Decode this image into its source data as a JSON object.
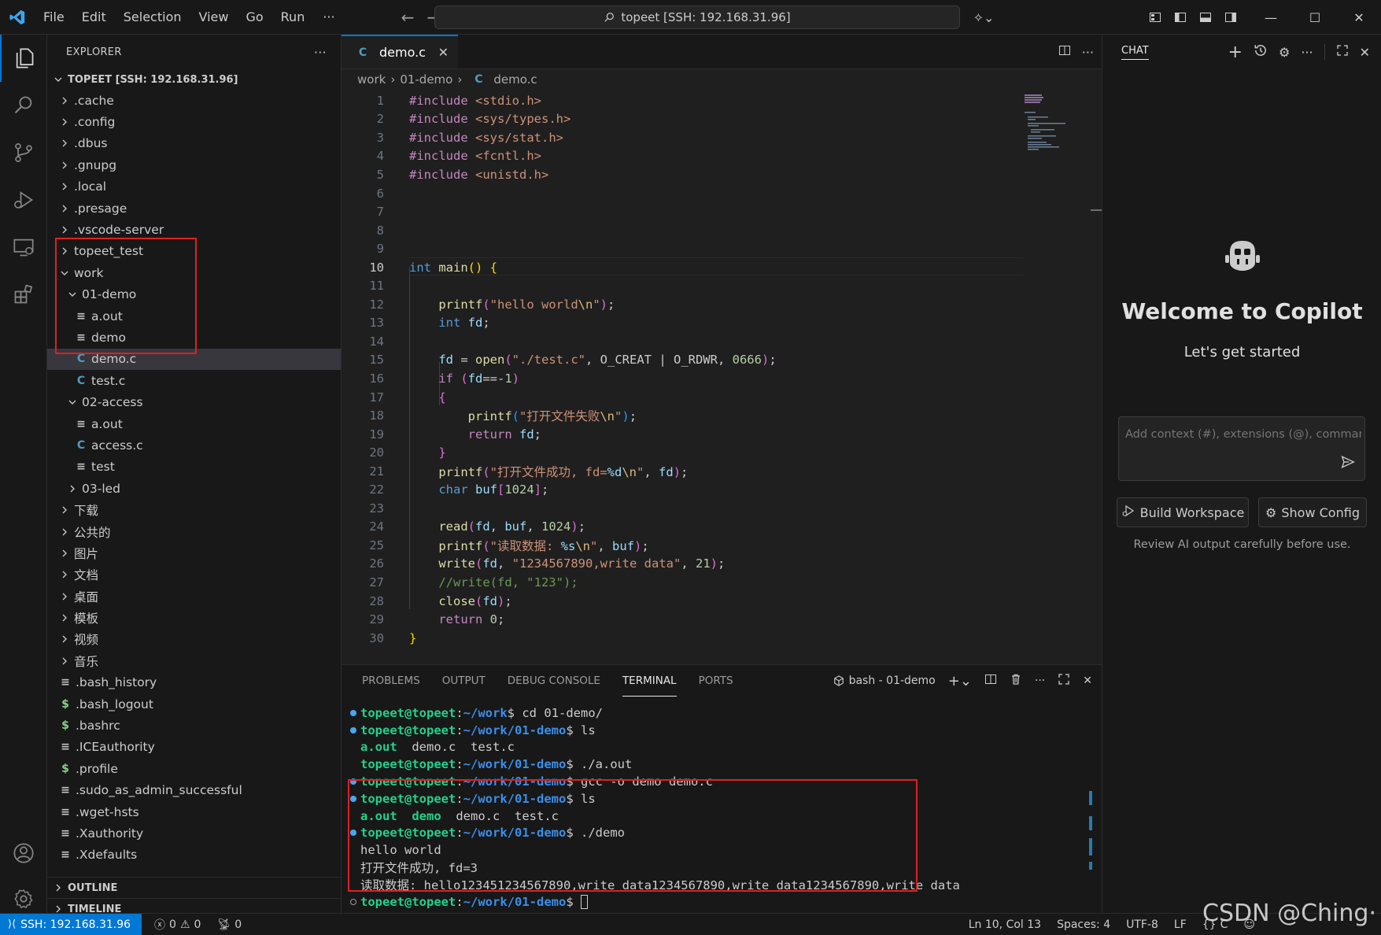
{
  "titlebar": {
    "menus": [
      "File",
      "Edit",
      "Selection",
      "View",
      "Go",
      "Run"
    ],
    "more": "···",
    "search_text": "topeet [SSH: 192.168.31.96]"
  },
  "explorer": {
    "title": "EXPLORER",
    "more": "···",
    "root": "TOPEET [SSH: 192.168.31.96]",
    "items": [
      {
        "label": ".cache",
        "kind": "folder",
        "depth": 1,
        "open": false
      },
      {
        "label": ".config",
        "kind": "folder",
        "depth": 1,
        "open": false
      },
      {
        "label": ".dbus",
        "kind": "folder",
        "depth": 1,
        "open": false
      },
      {
        "label": ".gnupg",
        "kind": "folder",
        "depth": 1,
        "open": false
      },
      {
        "label": ".local",
        "kind": "folder",
        "depth": 1,
        "open": false
      },
      {
        "label": ".presage",
        "kind": "folder",
        "depth": 1,
        "open": false
      },
      {
        "label": ".vscode-server",
        "kind": "folder",
        "depth": 1,
        "open": false
      },
      {
        "label": "topeet_test",
        "kind": "folder",
        "depth": 1,
        "open": false
      },
      {
        "label": "work",
        "kind": "folder",
        "depth": 1,
        "open": true
      },
      {
        "label": "01-demo",
        "kind": "folder",
        "depth": 2,
        "open": true
      },
      {
        "label": "a.out",
        "kind": "lines",
        "depth": 3
      },
      {
        "label": "demo",
        "kind": "lines",
        "depth": 3
      },
      {
        "label": "demo.c",
        "kind": "c",
        "depth": 3,
        "selected": true
      },
      {
        "label": "test.c",
        "kind": "c",
        "depth": 3
      },
      {
        "label": "02-access",
        "kind": "folder",
        "depth": 2,
        "open": true
      },
      {
        "label": "a.out",
        "kind": "lines",
        "depth": 3
      },
      {
        "label": "access.c",
        "kind": "c",
        "depth": 3
      },
      {
        "label": "test",
        "kind": "lines",
        "depth": 3
      },
      {
        "label": "03-led",
        "kind": "folder",
        "depth": 2,
        "open": false
      },
      {
        "label": "下载",
        "kind": "folder",
        "depth": 1,
        "open": false
      },
      {
        "label": "公共的",
        "kind": "folder",
        "depth": 1,
        "open": false
      },
      {
        "label": "图片",
        "kind": "folder",
        "depth": 1,
        "open": false
      },
      {
        "label": "文档",
        "kind": "folder",
        "depth": 1,
        "open": false
      },
      {
        "label": "桌面",
        "kind": "folder",
        "depth": 1,
        "open": false
      },
      {
        "label": "模板",
        "kind": "folder",
        "depth": 1,
        "open": false
      },
      {
        "label": "视频",
        "kind": "folder",
        "depth": 1,
        "open": false
      },
      {
        "label": "音乐",
        "kind": "folder",
        "depth": 1,
        "open": false
      },
      {
        "label": ".bash_history",
        "kind": "lines",
        "depth": 1
      },
      {
        "label": ".bash_logout",
        "kind": "dollar",
        "depth": 1
      },
      {
        "label": ".bashrc",
        "kind": "dollar",
        "depth": 1
      },
      {
        "label": ".ICEauthority",
        "kind": "lines",
        "depth": 1
      },
      {
        "label": ".profile",
        "kind": "dollar",
        "depth": 1
      },
      {
        "label": ".sudo_as_admin_successful",
        "kind": "lines",
        "depth": 1
      },
      {
        "label": ".wget-hsts",
        "kind": "lines",
        "depth": 1
      },
      {
        "label": ".Xauthority",
        "kind": "lines",
        "depth": 1
      },
      {
        "label": ".Xdefaults",
        "kind": "lines",
        "depth": 1
      }
    ],
    "outline": "OUTLINE",
    "timeline": "TIMELINE"
  },
  "editor": {
    "tab_label": "demo.c",
    "tab_icon": "C",
    "breadcrumb": [
      "work",
      "01-demo",
      "demo.c"
    ],
    "current_line": 10
  },
  "code": [
    [
      [
        "inc",
        "#include "
      ],
      [
        "str",
        "<stdio.h>"
      ]
    ],
    [
      [
        "inc",
        "#include "
      ],
      [
        "str",
        "<sys/types.h>"
      ]
    ],
    [
      [
        "inc",
        "#include "
      ],
      [
        "str",
        "<sys/stat.h>"
      ]
    ],
    [
      [
        "inc",
        "#include "
      ],
      [
        "str",
        "<fcntl.h>"
      ]
    ],
    [
      [
        "inc",
        "#include "
      ],
      [
        "str",
        "<unistd.h>"
      ]
    ],
    [],
    [],
    [],
    [],
    [
      [
        "kw",
        "int "
      ],
      [
        "fn",
        "main"
      ],
      [
        "br1",
        "()"
      ],
      [
        "",
        " "
      ],
      [
        "br1",
        "{"
      ]
    ],
    [],
    [
      [
        "",
        "    "
      ],
      [
        "fn",
        "printf"
      ],
      [
        "br2",
        "("
      ],
      [
        "str",
        "\"hello world"
      ],
      [
        "esc",
        "\\n"
      ],
      [
        "str",
        "\""
      ],
      [
        "br2",
        ")"
      ],
      [
        "",
        ";"
      ]
    ],
    [
      [
        "",
        "    "
      ],
      [
        "kw",
        "int "
      ],
      [
        "var",
        "fd"
      ],
      [
        "",
        ";"
      ]
    ],
    [],
    [
      [
        "",
        "    "
      ],
      [
        "var",
        "fd"
      ],
      [
        "",
        " = "
      ],
      [
        "fn",
        "open"
      ],
      [
        "br2",
        "("
      ],
      [
        "str",
        "\"./test.c\""
      ],
      [
        "",
        ", O_CREAT | O_RDWR, "
      ],
      [
        "num",
        "0666"
      ],
      [
        "br2",
        ")"
      ],
      [
        "",
        ";"
      ]
    ],
    [
      [
        "",
        "    "
      ],
      [
        "inc",
        "if "
      ],
      [
        "br2",
        "("
      ],
      [
        "var",
        "fd"
      ],
      [
        "",
        "=="
      ],
      [
        "",
        "-"
      ],
      [
        "num",
        "1"
      ],
      [
        "br2",
        ")"
      ]
    ],
    [
      [
        "",
        "    "
      ],
      [
        "br2",
        "{"
      ]
    ],
    [
      [
        "",
        "        "
      ],
      [
        "fn",
        "printf"
      ],
      [
        "br3",
        "("
      ],
      [
        "str",
        "\"打开文件失败"
      ],
      [
        "esc",
        "\\n"
      ],
      [
        "str",
        "\""
      ],
      [
        "br3",
        ")"
      ],
      [
        "",
        ";"
      ]
    ],
    [
      [
        "",
        "        "
      ],
      [
        "inc",
        "return "
      ],
      [
        "var",
        "fd"
      ],
      [
        "",
        ";"
      ]
    ],
    [
      [
        "",
        "    "
      ],
      [
        "br2",
        "}"
      ]
    ],
    [
      [
        "",
        "    "
      ],
      [
        "fn",
        "printf"
      ],
      [
        "br2",
        "("
      ],
      [
        "str",
        "\"打开文件成功, fd="
      ],
      [
        "var",
        "%d"
      ],
      [
        "esc",
        "\\n"
      ],
      [
        "str",
        "\""
      ],
      [
        "",
        ", "
      ],
      [
        "var",
        "fd"
      ],
      [
        "br2",
        ")"
      ],
      [
        "",
        ";"
      ]
    ],
    [
      [
        "",
        "    "
      ],
      [
        "kw",
        "char "
      ],
      [
        "var",
        "buf"
      ],
      [
        "br2",
        "["
      ],
      [
        "num",
        "1024"
      ],
      [
        "br2",
        "]"
      ],
      [
        "",
        ";"
      ]
    ],
    [],
    [
      [
        "",
        "    "
      ],
      [
        "fn",
        "read"
      ],
      [
        "br2",
        "("
      ],
      [
        "var",
        "fd"
      ],
      [
        "",
        ", "
      ],
      [
        "var",
        "buf"
      ],
      [
        "",
        ", "
      ],
      [
        "num",
        "1024"
      ],
      [
        "br2",
        ")"
      ],
      [
        "",
        ";"
      ]
    ],
    [
      [
        "",
        "    "
      ],
      [
        "fn",
        "printf"
      ],
      [
        "br2",
        "("
      ],
      [
        "str",
        "\"读取数据: "
      ],
      [
        "var",
        "%s"
      ],
      [
        "esc",
        "\\n"
      ],
      [
        "str",
        "\""
      ],
      [
        "",
        ", "
      ],
      [
        "var",
        "buf"
      ],
      [
        "br2",
        ")"
      ],
      [
        "",
        ";"
      ]
    ],
    [
      [
        "",
        "    "
      ],
      [
        "fn",
        "write"
      ],
      [
        "br2",
        "("
      ],
      [
        "var",
        "fd"
      ],
      [
        "",
        ", "
      ],
      [
        "str",
        "\"1234567890,write data\""
      ],
      [
        "",
        ", "
      ],
      [
        "num",
        "21"
      ],
      [
        "br2",
        ")"
      ],
      [
        "",
        ";"
      ]
    ],
    [
      [
        "",
        "    "
      ],
      [
        "cm",
        "//write(fd, \"123\");"
      ]
    ],
    [
      [
        "",
        "    "
      ],
      [
        "fn",
        "close"
      ],
      [
        "br2",
        "("
      ],
      [
        "var",
        "fd"
      ],
      [
        "br2",
        ")"
      ],
      [
        "",
        ";"
      ]
    ],
    [
      [
        "",
        "    "
      ],
      [
        "inc",
        "return "
      ],
      [
        "num",
        "0"
      ],
      [
        "",
        ";"
      ]
    ],
    [
      [
        "br1",
        "}"
      ]
    ]
  ],
  "panel": {
    "tabs": [
      "PROBLEMS",
      "OUTPUT",
      "DEBUG CONSOLE",
      "TERMINAL",
      "PORTS"
    ],
    "active_tab": "TERMINAL",
    "terminal_name": "bash - 01-demo"
  },
  "terminal": [
    {
      "dot": "blue",
      "prompt_user": "topeet@topeet",
      "prompt_path": "~/work",
      "cmd": "$ cd 01-demo/"
    },
    {
      "dot": "blue",
      "prompt_user": "topeet@topeet",
      "prompt_path": "~/work/01-demo",
      "cmd": "$ ls"
    },
    {
      "dot": "none",
      "out": [
        [
          "tgreen",
          "a.out"
        ],
        [
          "tplain",
          "  demo.c  test.c"
        ]
      ]
    },
    {
      "dot": "none",
      "prompt_user": "topeet@topeet",
      "prompt_path": "~/work/01-demo",
      "cmd": "$ ./a.out"
    },
    {
      "dot": "blue",
      "prompt_user": "topeet@topeet",
      "prompt_path": "~/work/01-demo",
      "cmd": "$ gcc -o demo demo.c"
    },
    {
      "dot": "blue",
      "prompt_user": "topeet@topeet",
      "prompt_path": "~/work/01-demo",
      "cmd": "$ ls"
    },
    {
      "dot": "none",
      "out": [
        [
          "tgreen",
          "a.out"
        ],
        [
          "tplain",
          "  "
        ],
        [
          "tgreen",
          "demo"
        ],
        [
          "tplain",
          "  demo.c  test.c"
        ]
      ]
    },
    {
      "dot": "blue",
      "prompt_user": "topeet@topeet",
      "prompt_path": "~/work/01-demo",
      "cmd": "$ ./demo"
    },
    {
      "dot": "none",
      "out": [
        [
          "tplain",
          "hello world"
        ]
      ]
    },
    {
      "dot": "none",
      "out": [
        [
          "tplain",
          "打开文件成功, fd=3"
        ]
      ]
    },
    {
      "dot": "none",
      "out": [
        [
          "tplain",
          "读取数据: hello123451234567890,write data1234567890,write data1234567890,write data"
        ]
      ]
    },
    {
      "dot": "hollow",
      "prompt_user": "topeet@topeet",
      "prompt_path": "~/work/01-demo",
      "cmd": "$ "
    }
  ],
  "chat": {
    "title": "CHAT",
    "welcome": "Welcome to Copilot",
    "subtitle": "Let's get started",
    "input_placeholder": "Add context (#), extensions (@), commands",
    "build_button": "Build Workspace",
    "config_button": "Show Config",
    "disclaimer": "Review AI output carefully before use."
  },
  "statusbar": {
    "remote": "SSH: 192.168.31.96",
    "errors": "0",
    "warnings": "0",
    "ports": "0",
    "position": "Ln 10, Col 13",
    "spaces": "Spaces: 4",
    "encoding": "UTF-8",
    "eol": "LF",
    "language": "C"
  },
  "watermark": "CSDN @Ching·"
}
